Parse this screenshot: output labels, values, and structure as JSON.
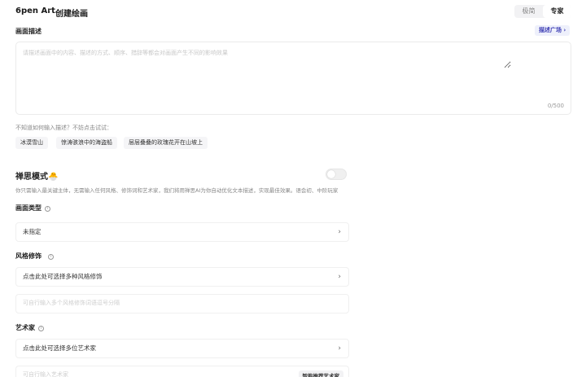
{
  "header": {
    "brand": "6pen Art",
    "separator": "·",
    "title": "创建绘画",
    "modes": [
      "极简",
      "专家"
    ],
    "active_mode": "专家"
  },
  "prompt": {
    "label": "画面描述",
    "square_link": "描述广场 ›",
    "placeholder": "请描述画面中的内容、描述的方式、顺序、措辞等都会对画面产生不同的影响效果",
    "counter": "0/500"
  },
  "suggestions": {
    "tip": "不知道如何输入描述？不妨点击试试：",
    "chips": [
      "冰漠雪山",
      "惊涛骇浪中的海盗船",
      "层层叠叠的玫瑰花开在山坡上"
    ]
  },
  "magic": {
    "title": "禅思模式🐣",
    "description": "你只需输入最关键主体，无需输入任何风格、修饰词和艺术家，我们将用禅思AI为你自动优化文本描述，实现最佳效果。语会初、中阶玩家"
  },
  "scene_type": {
    "label": "画面类型",
    "value": "未指定"
  },
  "style": {
    "label": "风格修饰",
    "value": "点击此处可选择多种风格修饰",
    "input_placeholder": "可自行输入多个风格修饰词语逗号分隔"
  },
  "artist": {
    "label": "艺术家",
    "value": "点击此处可选择多位艺术家",
    "input_placeholder": "可自行输入艺术家",
    "recommend_label": "智能推荐艺术家"
  },
  "icons": {
    "hint": "info-circle-icon",
    "chevron": "chevron-right-icon"
  }
}
